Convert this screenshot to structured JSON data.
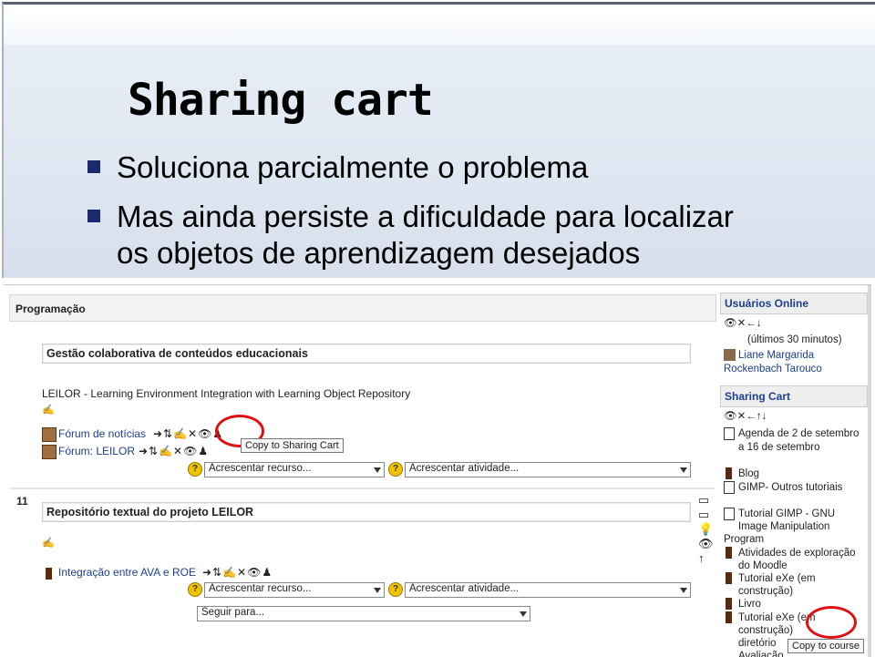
{
  "slide": {
    "title": "Sharing cart",
    "bullets": [
      "Soluciona parcialmente o problema",
      "Mas ainda persiste a dificuldade para localizar",
      "os objetos de aprendizagem desejados"
    ]
  },
  "course": {
    "header": "Programação",
    "section1": {
      "title": "Gestão colaborativa de conteúdos educacionais",
      "summary": "LEILOR - Learning Environment Integration with Learning Object Repository",
      "items": [
        {
          "label": "Fórum de notícias",
          "icons": "➜⇅✍✕👁♟"
        },
        {
          "label": "Fórum: LEILOR",
          "icons": "➜⇅✍✕👁♟"
        }
      ],
      "add_resource": "Acrescentar recurso...",
      "add_activity": "Acrescentar atividade..."
    },
    "tooltip": "Copy to Sharing Cart",
    "section2": {
      "number": "11",
      "title": "Repositório textual do projeto LEILOR",
      "items": [
        {
          "label": "Integração entre AVA e ROE",
          "icons": "➜⇅✍✕👁♟"
        }
      ],
      "add_resource": "Acrescentar recurso...",
      "add_activity": "Acrescentar atividade..."
    },
    "jump_to": "Seguir para..."
  },
  "sidebar": {
    "online_title": "Usuários Online",
    "online_icons": "👁✕←↓",
    "online_period": "(últimos 30 minutos)",
    "online_user": "Liane Margarida",
    "online_user2": "Rockenbach Tarouco",
    "cart_title": "Sharing Cart",
    "cart_icons": "👁✕←↑↓",
    "cart_items": [
      "Agenda de 2 de setembro",
      "a 16 de setembro",
      "Blog",
      "GIMP- Outros tutoriais",
      "Tutorial GIMP - GNU",
      "Image Manipulation",
      "Program",
      "Atividades de exploração",
      "do Moodle",
      "Tutorial eXe (em",
      "construção)",
      "Livro",
      "Tutorial eXe (em",
      "construção)",
      "diretório",
      "Avaliação"
    ],
    "copy_to_course": "Copy to course"
  }
}
